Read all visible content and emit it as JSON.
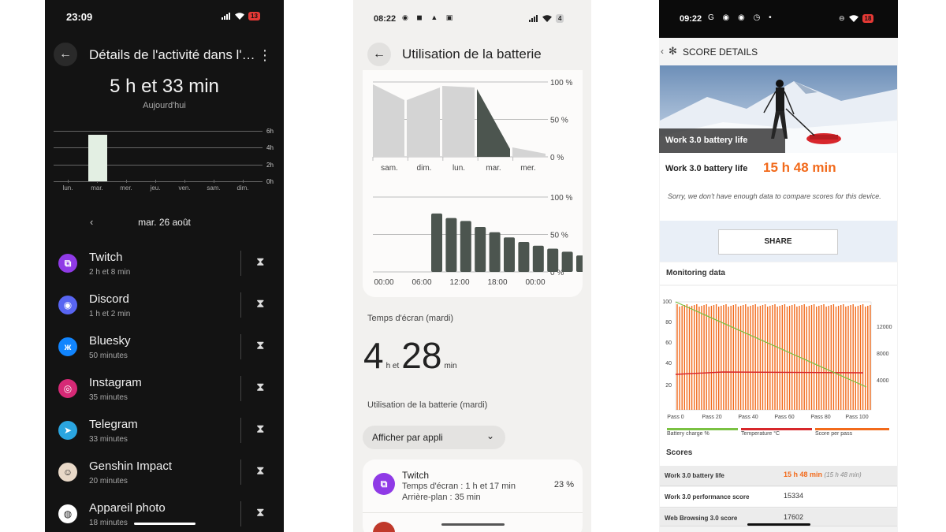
{
  "colors": {
    "dark_bg": "#131313",
    "twitch": "#8f3ae6",
    "discord": "#5865f2",
    "bluesky": "#1185fe",
    "telegram": "#2aa5e0",
    "accent_orange": "#f26a1b",
    "battery_green": "#7ac142",
    "temperature_red": "#d7262a"
  },
  "phone1": {
    "status": {
      "time": "23:09",
      "battery": "13"
    },
    "title": "Détails de l'activité dans l'a...",
    "total": "5 h et 33 min",
    "period": "Aujourd'hui",
    "chart_data": {
      "type": "bar",
      "categories": [
        "lun.",
        "mar.",
        "mer.",
        "jeu.",
        "ven.",
        "sam.",
        "dim."
      ],
      "values": [
        0,
        5.55,
        0,
        0,
        0,
        0,
        0
      ],
      "y_ticks": [
        "6h",
        "4h",
        "2h",
        "0h"
      ],
      "ylim": [
        0,
        6
      ]
    },
    "date": "mar. 26 août",
    "apps": [
      {
        "name": "Twitch",
        "duration": "2 h et 8 min",
        "icon": "twitch-icon",
        "glyph": "⧉"
      },
      {
        "name": "Discord",
        "duration": "1 h et 2 min",
        "icon": "discord-icon",
        "glyph": "◉"
      },
      {
        "name": "Bluesky",
        "duration": "50 minutes",
        "icon": "bluesky-icon",
        "glyph": "ж"
      },
      {
        "name": "Instagram",
        "duration": "35 minutes",
        "icon": "instagram-icon",
        "glyph": "◎"
      },
      {
        "name": "Telegram",
        "duration": "33 minutes",
        "icon": "telegram-icon",
        "glyph": "➤"
      },
      {
        "name": "Genshin Impact",
        "duration": "20 minutes",
        "icon": "genshin-icon",
        "glyph": "☺"
      },
      {
        "name": "Appareil photo",
        "duration": "18 minutes",
        "icon": "camera-icon",
        "glyph": "◍"
      }
    ]
  },
  "phone2": {
    "status": {
      "time": "08:22",
      "battery": "4"
    },
    "title": "Utilisation de la batterie",
    "chart_data": [
      {
        "type": "area",
        "categories": [
          "sam.",
          "dim.",
          "lun.",
          "mar.",
          "mer."
        ],
        "y_ticks": [
          "100 %",
          "50 %",
          "0 %"
        ],
        "ylim": [
          0,
          100
        ]
      },
      {
        "type": "bar",
        "x_ticks": [
          "00:00",
          "06:00",
          "12:00",
          "18:00",
          "00:00"
        ],
        "values": [
          78,
          72,
          68,
          60,
          53,
          46,
          40,
          35,
          31,
          27,
          22
        ],
        "y_ticks": [
          "100 %",
          "50 %",
          "0 %"
        ],
        "ylim": [
          0,
          100
        ]
      }
    ],
    "screen_label": "Temps d'écran (mardi)",
    "screen_hours": "4",
    "screen_h_unit": "h et",
    "screen_minutes": "28",
    "screen_min_unit": "min",
    "battery_label": "Utilisation de la batterie (mardi)",
    "filter": "Afficher par appli",
    "app": {
      "name": "Twitch",
      "screen_time": "Temps d'écran : 1 h et 17 min",
      "background": "Arrière-plan : 35 min",
      "percent": "23 %"
    }
  },
  "phone3": {
    "status": {
      "time": "09:22",
      "battery": "18"
    },
    "header": "SCORE DETAILS",
    "hero_caption": "Work 3.0 battery life",
    "score_label": "Work 3.0 battery life",
    "score_value": "15 h 48 min",
    "sorry": "Sorry, we don't have enough data to compare scores for this device.",
    "share": "SHARE",
    "monitoring": "Monitoring data",
    "chart_data": {
      "type": "line",
      "x_ticks": [
        "Pass 0",
        "Pass 20",
        "Pass 40",
        "Pass 60",
        "Pass 80",
        "Pass 100"
      ],
      "y_left_ticks": [
        "100",
        "80",
        "60",
        "40",
        "20"
      ],
      "y_right_ticks": [
        "12000",
        "8000",
        "4000"
      ],
      "series": [
        {
          "name": "Battery charge %",
          "x": [
            0,
            100
          ],
          "values": [
            100,
            20
          ]
        },
        {
          "name": "Temperature °C",
          "x": [
            0,
            100
          ],
          "values": [
            32,
            33
          ]
        },
        {
          "name": "Score per pass",
          "values": [
            14800,
            15000,
            15400,
            14900,
            15200
          ]
        }
      ]
    },
    "scores_title": "Scores",
    "scores": [
      {
        "name": "Work 3.0 battery life",
        "value": "15 h 48 min",
        "extra": "(15 h 48 min)"
      },
      {
        "name": "Work 3.0 performance score",
        "value": "15334",
        "extra": ""
      },
      {
        "name": "Web Browsing 3.0 score",
        "value": "17602",
        "extra": ""
      }
    ]
  }
}
